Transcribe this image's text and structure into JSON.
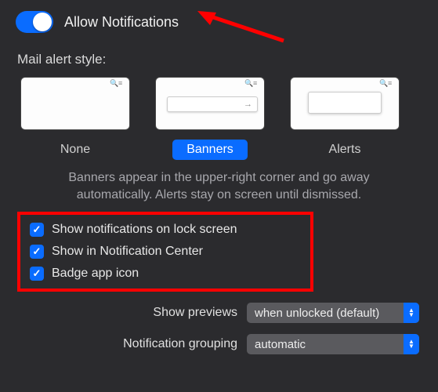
{
  "toggle": {
    "label": "Allow Notifications",
    "enabled": true
  },
  "section_label": "Mail alert style:",
  "styles": [
    {
      "name": "None",
      "selected": false
    },
    {
      "name": "Banners",
      "selected": true
    },
    {
      "name": "Alerts",
      "selected": false
    }
  ],
  "description": "Banners appear in the upper-right corner and go away automatically. Alerts stay on screen until dismissed.",
  "checkboxes": [
    {
      "label": "Show notifications on lock screen",
      "checked": true
    },
    {
      "label": "Show in Notification Center",
      "checked": true
    },
    {
      "label": "Badge app icon",
      "checked": true
    }
  ],
  "dropdowns": {
    "previews": {
      "label": "Show previews",
      "value": "when unlocked (default)"
    },
    "grouping": {
      "label": "Notification grouping",
      "value": "automatic"
    }
  }
}
